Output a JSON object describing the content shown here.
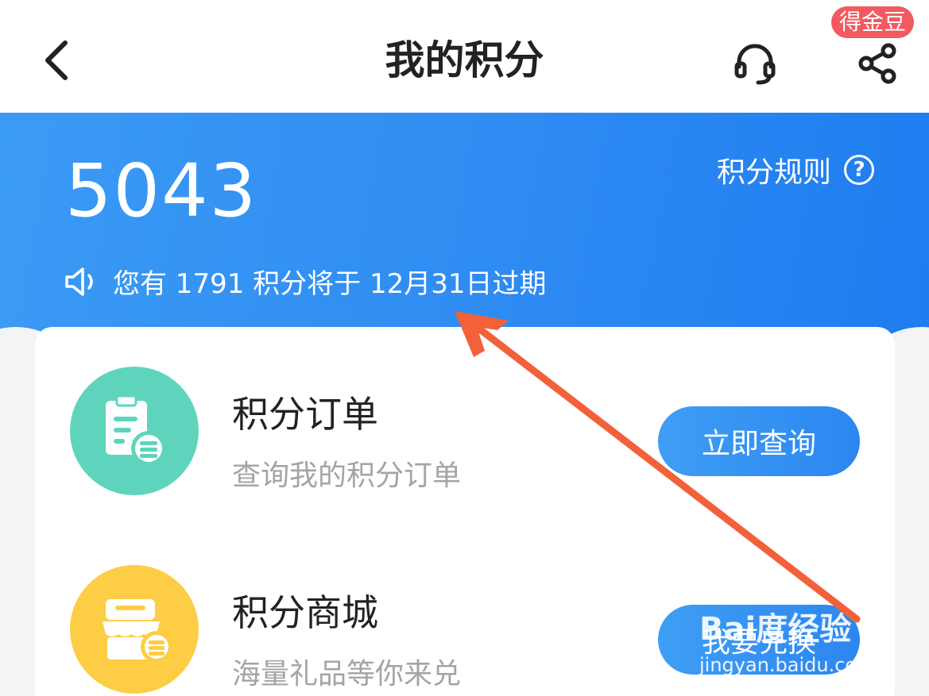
{
  "header": {
    "title": "我的积分",
    "badge": "得金豆"
  },
  "hero": {
    "points": "5043",
    "rules_label": "积分规则",
    "help_symbol": "?",
    "expire_notice": "您有 1791 积分将于 12月31日过期"
  },
  "items": [
    {
      "title": "积分订单",
      "subtitle": "查询我的积分订单",
      "button": "立即查询",
      "icon": "clipboard-coins-icon",
      "color": "#5fd4bd"
    },
    {
      "title": "积分商城",
      "subtitle": "海量礼品等你来兑",
      "button": "我要兑换",
      "icon": "shop-coins-icon",
      "color": "#fccd45"
    }
  ],
  "watermark": {
    "main": "Bai度经验",
    "sub": "jingyan.baidu.com"
  },
  "colors": {
    "primary": "#2e8bf2",
    "annotation_arrow": "#f2613a",
    "badge": "#f15a5f"
  }
}
